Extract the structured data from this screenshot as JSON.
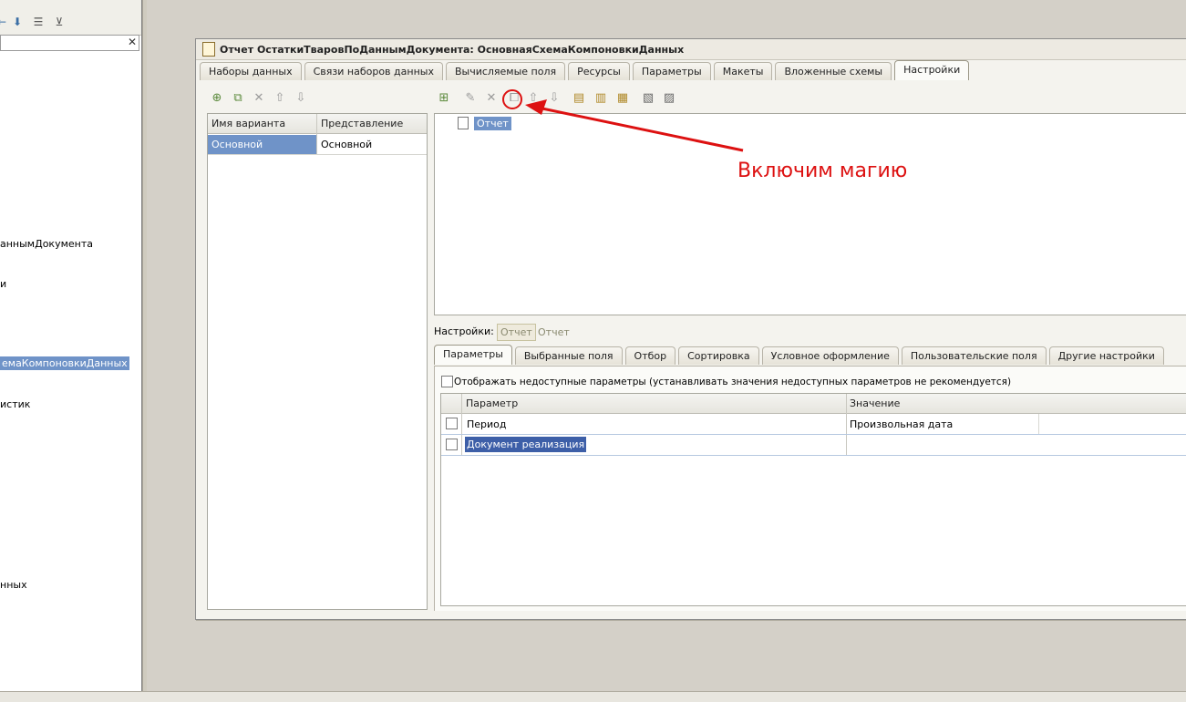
{
  "left_panel": {
    "tree_items": [
      {
        "text": "аннымДокумента"
      },
      {
        "text": "и"
      },
      {
        "text": "емаКомпоновкиДанных",
        "selected": true
      },
      {
        "text": "истик"
      },
      {
        "text": "нных"
      }
    ]
  },
  "window": {
    "title": "Отчет ОстаткиТваровПоДаннымДокумента: ОсновнаяСхемаКомпоновкиДанных",
    "tabs": [
      "Наборы данных",
      "Связи наборов данных",
      "Вычисляемые поля",
      "Ресурсы",
      "Параметры",
      "Макеты",
      "Вложенные схемы",
      "Настройки"
    ],
    "active_tab": "Настройки"
  },
  "variants": {
    "columns": [
      "Имя варианта",
      "Представление"
    ],
    "rows": [
      {
        "name": "Основной",
        "presentation": "Основной"
      }
    ]
  },
  "structure": {
    "root_label": "Отчет"
  },
  "annotation": {
    "text": "Включим магию",
    "color": "#dd1111"
  },
  "settings": {
    "label": "Настройки:",
    "current_button": "Отчет",
    "current_text": "Отчет",
    "tabs": [
      "Параметры",
      "Выбранные поля",
      "Отбор",
      "Сортировка",
      "Условное оформление",
      "Пользовательские поля",
      "Другие настройки"
    ],
    "active_tab": "Параметры",
    "show_unavailable_label": "Отображать недоступные параметры (устанавливать значения недоступных параметров не рекомендуется)",
    "params_columns": [
      "Параметр",
      "Значение"
    ],
    "params_rows": [
      {
        "param": "Период",
        "value": "Произвольная дата"
      },
      {
        "param": "Документ реализация",
        "value": ""
      }
    ]
  },
  "colors": {
    "selection": "#6f93c8",
    "accent_red": "#dd1111"
  },
  "icons": [
    "up-arrow-icon",
    "down-arrow-icon",
    "list-icon",
    "filter-icon",
    "close-icon",
    "add-icon",
    "copy-icon",
    "delete-icon",
    "edit-icon",
    "document-icon"
  ]
}
